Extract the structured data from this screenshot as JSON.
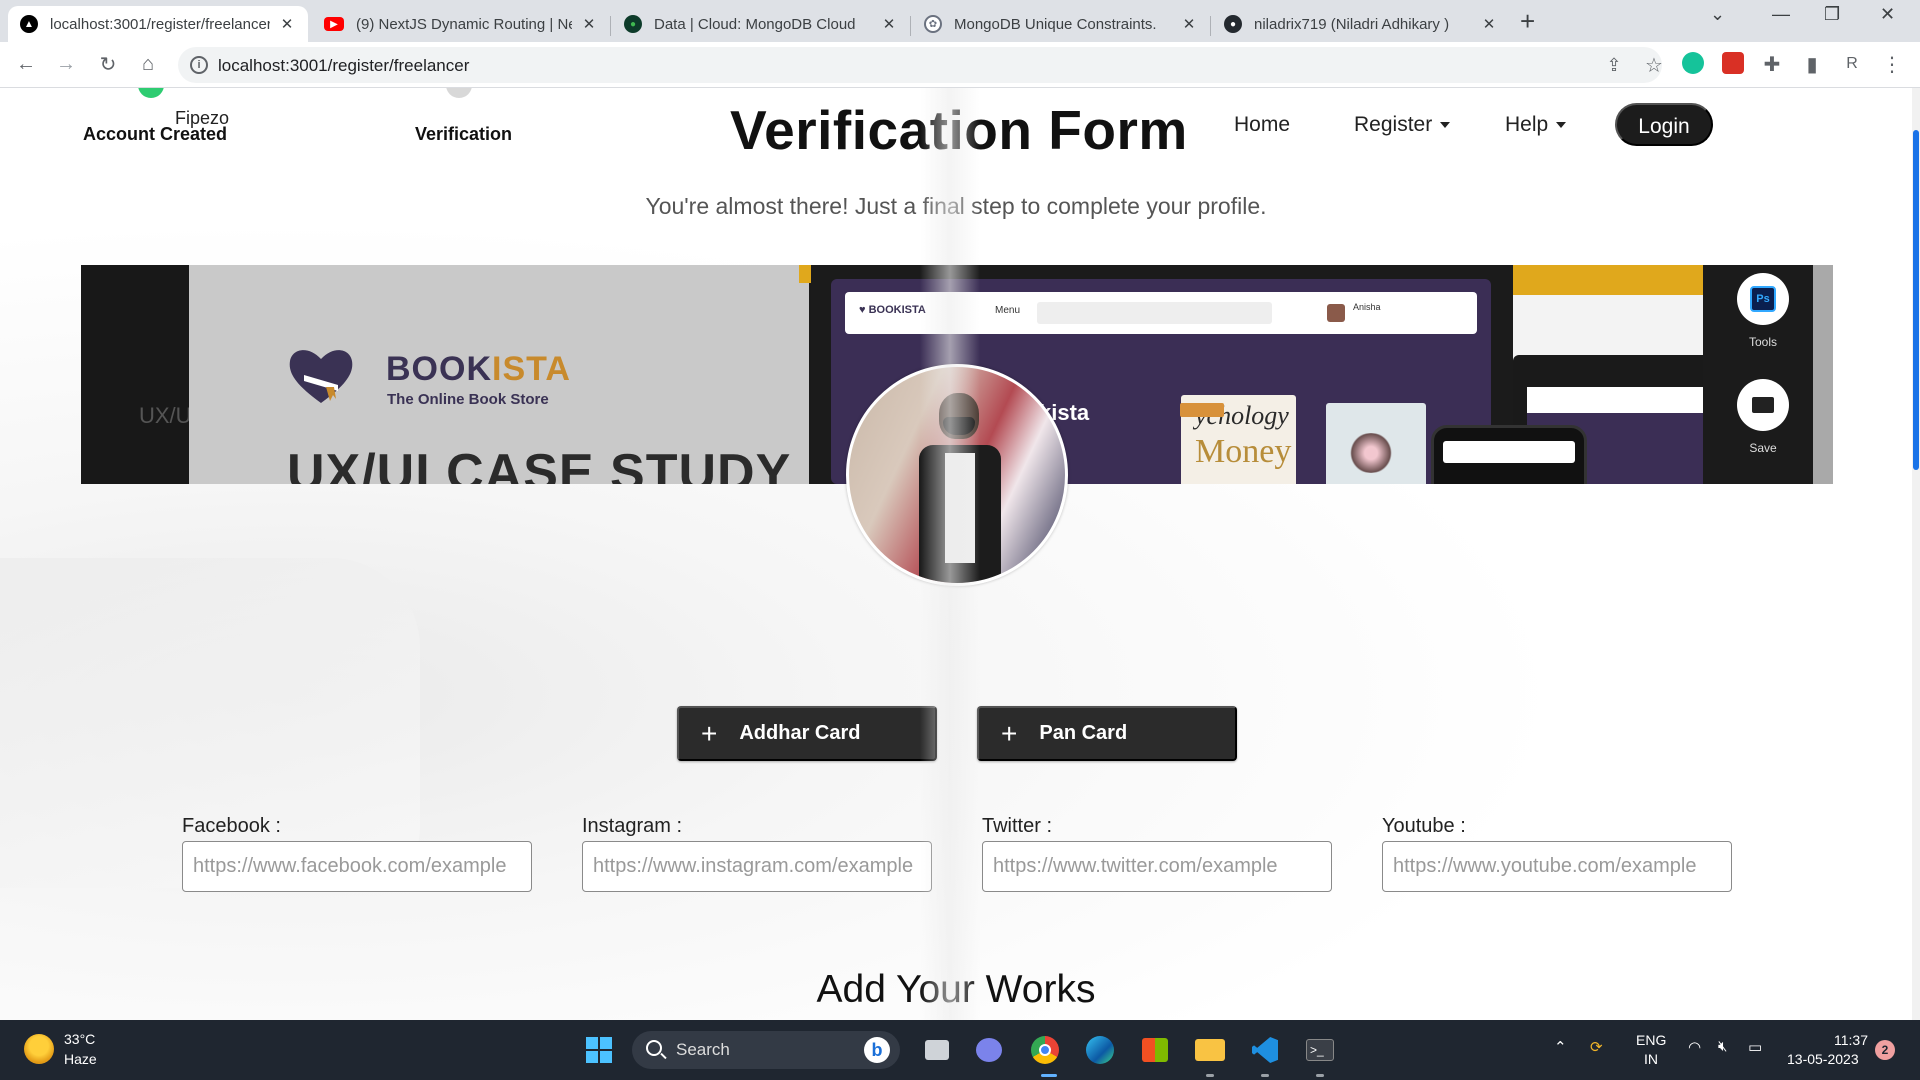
{
  "browser": {
    "tabs": [
      {
        "title": "localhost:3001/register/freelancer",
        "active": true,
        "favicon": "nextjs-icon"
      },
      {
        "title": "(9) NextJS Dynamic Routing | Ne",
        "active": false,
        "favicon": "youtube-icon"
      },
      {
        "title": "Data | Cloud: MongoDB Cloud",
        "active": false,
        "favicon": "mongodb-icon"
      },
      {
        "title": "MongoDB Unique Constraints.",
        "active": false,
        "favicon": "chatgpt-icon"
      },
      {
        "title": "niladrix719 (Niladri Adhikary )",
        "active": false,
        "favicon": "github-icon"
      }
    ],
    "url": "localhost:3001/register/freelancer",
    "profile_initial": "R"
  },
  "page": {
    "brand": "Fipezo",
    "steps": [
      {
        "label": "Account Created",
        "status": "done",
        "color": "#2ecc71"
      },
      {
        "label": "Verification",
        "status": "pending",
        "color": "#cfcfcf"
      }
    ],
    "title": "Verification Form",
    "nav": {
      "home": "Home",
      "register": "Register",
      "help": "Help",
      "login": "Login"
    },
    "subtitle": "You're almost there! Just a final step to complete your profile.",
    "banner": {
      "brand_prefix": "BOOK",
      "brand_suffix": "ISTA",
      "tagline": "The Online Book Store",
      "case_study": "UX/UI CASE STUDY",
      "kista_text": "kista",
      "book_title_1": "ychology",
      "book_title_2": "Money",
      "menu_text": "Menu",
      "user_name": "Anisha",
      "tools_label": "Tools",
      "save_label": "Save",
      "ps_label": "Ps"
    },
    "upload_buttons": [
      {
        "label": "Addhar Card"
      },
      {
        "label": "Pan Card"
      }
    ],
    "socials": [
      {
        "label": "Facebook :",
        "placeholder": "https://www.facebook.com/example",
        "value": ""
      },
      {
        "label": "Instagram :",
        "placeholder": "https://www.instagram.com/example",
        "value": ""
      },
      {
        "label": "Twitter :",
        "placeholder": "https://www.twitter.com/example",
        "value": ""
      },
      {
        "label": "Youtube :",
        "placeholder": "https://www.youtube.com/example",
        "value": ""
      }
    ],
    "works_title": "Add Your Works"
  },
  "taskbar": {
    "weather": {
      "temp": "33°C",
      "condition": "Haze"
    },
    "search": "Search",
    "lang_top": "ENG",
    "lang_bottom": "IN",
    "time": "11:37",
    "date": "13-05-2023",
    "notifications": "2"
  }
}
